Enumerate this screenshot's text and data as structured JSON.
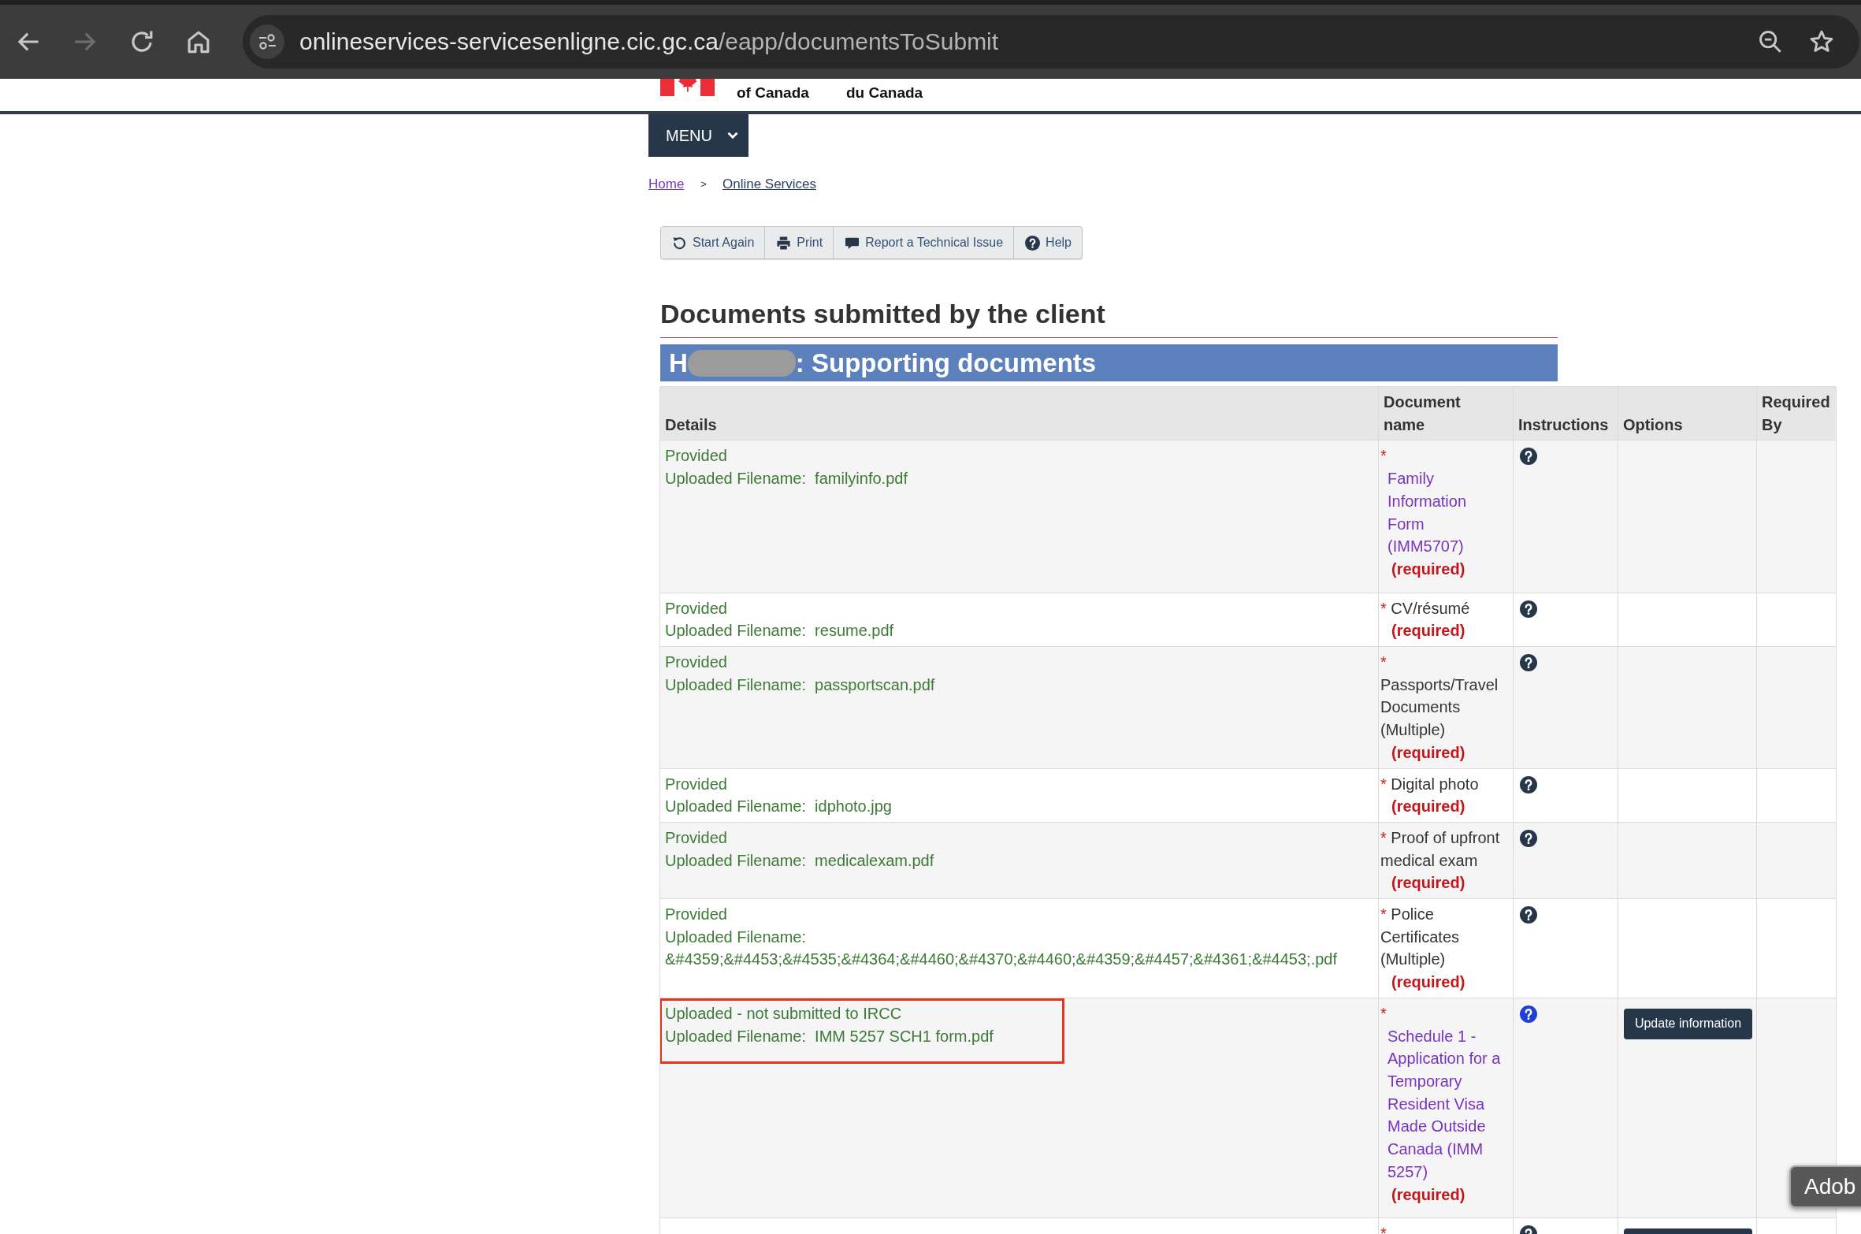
{
  "browser": {
    "url_host": "onlineservices-servicesenligne.cic.gc.ca",
    "url_path": "/eapp/documentsToSubmit"
  },
  "gov_header": {
    "lines": [
      "of Canada",
      "du Canada"
    ]
  },
  "menu": {
    "label": "MENU"
  },
  "breadcrumb": {
    "separator": ">",
    "items": [
      {
        "label": "Home",
        "visited": true
      },
      {
        "label": "Online Services",
        "visited": false
      }
    ]
  },
  "toolbar": [
    {
      "kind": "restart",
      "label": "Start Again"
    },
    {
      "kind": "print",
      "label": "Print"
    },
    {
      "kind": "report",
      "label": "Report a Technical Issue"
    },
    {
      "kind": "help",
      "label": "Help"
    }
  ],
  "heading": "Documents submitted by the client",
  "banner": {
    "text_before": "H",
    "redacted": true,
    "text_after": ": Supporting documents"
  },
  "table": {
    "columns": [
      "Details",
      "Document name",
      "Instructions",
      "Options",
      "Required By"
    ],
    "rows": [
      {
        "status": "Provided",
        "file": "Uploaded Filename:  familyinfo.pdf",
        "highlighted": false,
        "document": {
          "mark": "*",
          "kind": "link",
          "name": "Family Information Form (IMM5707)",
          "required": "(required)"
        },
        "help": {
          "color": "#26374a"
        }
      },
      {
        "status": "Provided",
        "file": "Uploaded Filename:  resume.pdf",
        "highlighted": false,
        "document": {
          "mark": "*",
          "kind": "plain",
          "name": "CV/résumé",
          "required": "(required)"
        },
        "help": {
          "color": "#26374a"
        }
      },
      {
        "status": "Provided",
        "file": "Uploaded Filename:  passportscan.pdf",
        "highlighted": false,
        "document": {
          "mark": "*",
          "kind": "plain",
          "name": "Passports/Travel Documents (Multiple)",
          "required": "(required)"
        },
        "help": {
          "color": "#26374a"
        }
      },
      {
        "status": "Provided",
        "file": "Uploaded Filename:  idphoto.jpg",
        "highlighted": false,
        "document": {
          "mark": "*",
          "kind": "plain",
          "name": "Digital photo",
          "required": "(required)"
        },
        "help": {
          "color": "#26374a"
        }
      },
      {
        "status": "Provided",
        "file": "Uploaded Filename:  medicalexam.pdf",
        "highlighted": false,
        "document": {
          "mark": "*",
          "kind": "plain",
          "name": "Proof of upfront medical exam",
          "required": "(required)"
        },
        "help": {
          "color": "#26374a"
        }
      },
      {
        "status": "Provided",
        "file": "Uploaded Filename:  &#4359;&#4453;&#4535;&#4364;&#4460;&#4370;&#4460;&#4359;&#4457;&#4361;&#4453;.pdf",
        "highlighted": false,
        "document": {
          "mark": "*",
          "kind": "plain",
          "name": "Police Certificates (Multiple)",
          "required": "(required)"
        },
        "help": {
          "color": "#26374a"
        }
      },
      {
        "status": "Uploaded - not submitted to IRCC",
        "file": "Uploaded Filename:  IMM 5257 SCH1 form.pdf",
        "highlighted": true,
        "document": {
          "mark": "*",
          "kind": "link",
          "name": "Schedule 1 - Application for a Temporary Resident Visa Made Outside Canada (IMM 5257)",
          "required": "(required)"
        },
        "help": {
          "color": "#1f3fd6"
        },
        "option": {
          "kind": "button",
          "label": "Update information"
        }
      },
      {
        "highlighted": false,
        "document": {
          "mark": "*"
        },
        "help": {
          "color": "#26374a"
        },
        "option": {
          "kind": "button"
        }
      }
    ]
  },
  "overlay_button": {
    "label": "Adob"
  }
}
